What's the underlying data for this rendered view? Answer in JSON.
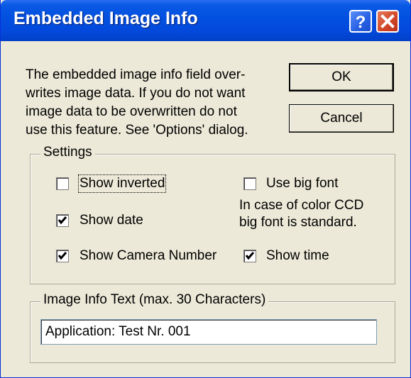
{
  "window": {
    "title": "Embedded Image Info",
    "help_glyph": "?",
    "close_glyph": "X"
  },
  "info_text": "The embedded image info field over-\nwrites image data. If you do not want\nimage data to be overwritten do not\nuse this feature. See 'Options' dialog.",
  "buttons": {
    "ok": "OK",
    "cancel": "Cancel"
  },
  "settings": {
    "label": "Settings",
    "show_inverted": {
      "label": "Show inverted",
      "checked": false
    },
    "use_big_font": {
      "label": "Use big font",
      "checked": false
    },
    "show_date": {
      "label": "Show date",
      "checked": true
    },
    "color_ccd_note": "In case of color CCD\nbig font is standard.",
    "show_camera_number": {
      "label": "Show Camera Number",
      "checked": true
    },
    "show_time": {
      "label": "Show time",
      "checked": true
    }
  },
  "image_info": {
    "label": "Image Info Text (max. 30 Characters)",
    "value": "Application: Test Nr. 001"
  },
  "colors": {
    "titlebar": "#0351e0",
    "dialog_bg": "#ece9d8",
    "close_button": "#d4482a",
    "group_border": "#aca899"
  }
}
